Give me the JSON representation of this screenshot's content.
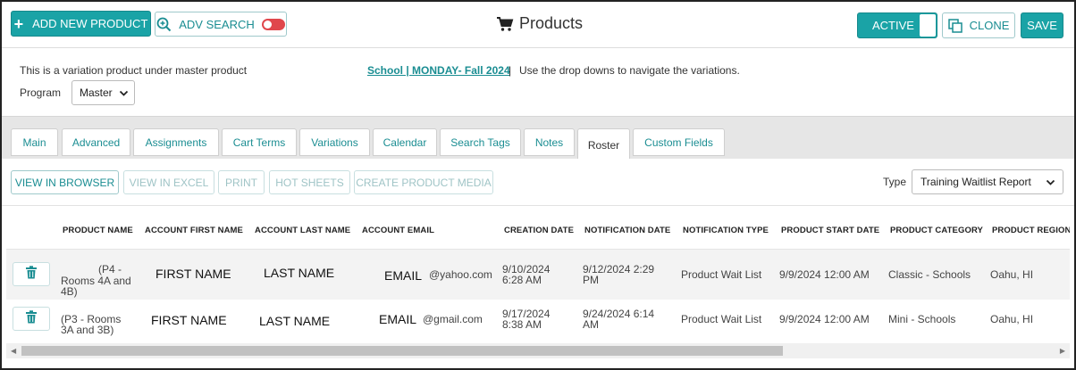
{
  "toolbar": {
    "add_label": "ADD NEW PRODUCT",
    "adv_search_label": "ADV SEARCH",
    "title": "Products",
    "active_label": "ACTIVE",
    "clone_label": "CLONE",
    "save_label": "SAVE",
    "accent_color": "#1aa3a6",
    "toggle_color": "#e0474c"
  },
  "info": {
    "note": "This is a variation product under master product",
    "master_link": "School | MONDAY- Fall 2024",
    "separator": "|",
    "hint": "Use the drop downs to navigate the variations.",
    "program_label": "Program",
    "program_value": "Master"
  },
  "tabs": [
    {
      "label": "Main"
    },
    {
      "label": "Advanced"
    },
    {
      "label": "Assignments"
    },
    {
      "label": "Cart Terms"
    },
    {
      "label": "Variations"
    },
    {
      "label": "Calendar"
    },
    {
      "label": "Search Tags"
    },
    {
      "label": "Notes"
    },
    {
      "label": "Roster"
    },
    {
      "label": "Custom Fields"
    }
  ],
  "active_tab": "Roster",
  "report_toolbar": {
    "view_browser": "VIEW IN BROWSER",
    "view_excel": "VIEW IN EXCEL",
    "print": "PRINT",
    "hot_sheets": "HOT SHEETS",
    "create_media": "CREATE PRODUCT MEDIA",
    "type_label": "Type",
    "type_value": "Training Waitlist Report"
  },
  "table": {
    "columns": [
      "PRODUCT NAME",
      "ACCOUNT FIRST NAME",
      "ACCOUNT LAST NAME",
      "ACCOUNT EMAIL",
      "CREATION DATE",
      "NOTIFICATION DATE",
      "NOTIFICATION TYPE",
      "PRODUCT START DATE",
      "PRODUCT CATEGORY",
      "PRODUCT REGION"
    ],
    "rows": [
      {
        "product_line1": "(P4 -",
        "product_line2": "Rooms 4A and",
        "product_line3": "4B)",
        "first_name": "FIRST NAME",
        "last_name": "LAST NAME",
        "email_label": "EMAIL",
        "email_domain": "@yahoo.com",
        "creation_line1": "9/10/2024",
        "creation_line2": "6:28 AM",
        "notif_line1": "9/12/2024 2:29",
        "notif_line2": "PM",
        "notif_type": "Product Wait List",
        "start_date": "9/9/2024 12:00 AM",
        "category": "Classic - Schools",
        "region": "Oahu, HI"
      },
      {
        "product_line1": "(P3 - Rooms",
        "product_line2": "3A and 3B)",
        "first_name": "FIRST NAME",
        "last_name": "LAST NAME",
        "email_label": "EMAIL",
        "email_domain": "@gmail.com",
        "creation_line1": "9/17/2024",
        "creation_line2": "8:38 AM",
        "notif_line1": "9/24/2024 6:14",
        "notif_line2": "AM",
        "notif_type": "Product Wait List",
        "start_date": "9/9/2024 12:00 AM",
        "category": "Mini - Schools",
        "region": "Oahu, HI"
      }
    ]
  },
  "scrollbar": {
    "position": 0.0
  }
}
